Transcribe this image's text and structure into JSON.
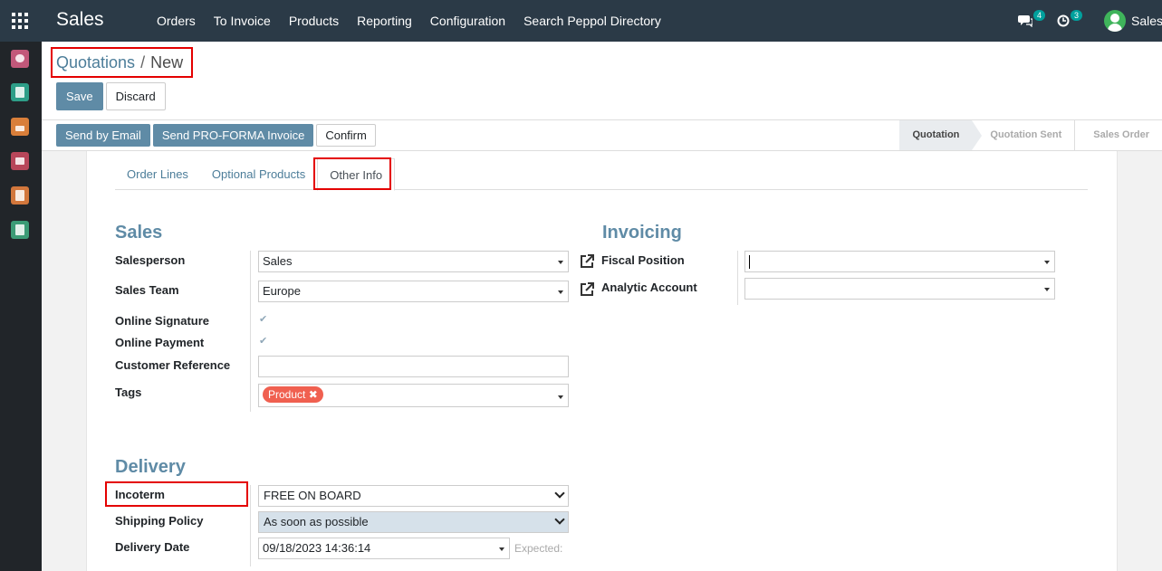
{
  "topbar": {
    "app_title": "Sales",
    "menu": [
      "Orders",
      "To Invoice",
      "Products",
      "Reporting",
      "Configuration",
      "Search Peppol Directory"
    ],
    "messages_count": "4",
    "activities_count": "3",
    "user_name": "Sales"
  },
  "breadcrumb": {
    "parent": "Quotations",
    "separator": "/",
    "current": "New"
  },
  "actions": {
    "save": "Save",
    "discard": "Discard"
  },
  "statusbar": {
    "buttons": [
      "Send by Email",
      "Send PRO-FORMA Invoice",
      "Confirm"
    ],
    "stages": [
      "Quotation",
      "Quotation Sent",
      "Sales Order"
    ],
    "active_stage": "Quotation"
  },
  "tabs": [
    "Order Lines",
    "Optional Products",
    "Other Info"
  ],
  "active_tab": "Other Info",
  "sales": {
    "title": "Sales",
    "salesperson_label": "Salesperson",
    "salesperson_value": "Sales",
    "sales_team_label": "Sales Team",
    "sales_team_value": "Europe",
    "online_signature_label": "Online Signature",
    "online_signature_checked": true,
    "online_payment_label": "Online Payment",
    "online_payment_checked": true,
    "customer_reference_label": "Customer Reference",
    "customer_reference_value": "",
    "tags_label": "Tags",
    "tag": "Product"
  },
  "invoicing": {
    "title": "Invoicing",
    "fiscal_position_label": "Fiscal Position",
    "fiscal_position_value": "",
    "analytic_account_label": "Analytic Account",
    "analytic_account_value": ""
  },
  "delivery": {
    "title": "Delivery",
    "incoterm_label": "Incoterm",
    "incoterm_value": "FREE ON BOARD",
    "shipping_policy_label": "Shipping Policy",
    "shipping_policy_value": "As soon as possible",
    "delivery_date_label": "Delivery Date",
    "delivery_date_value": "09/18/2023 14:36:14",
    "expected_label": "Expected:"
  },
  "colors": {
    "navbar": "#2b3a47",
    "primary": "#5f8ba6",
    "highlight": "#e40000",
    "tag": "#f06050"
  },
  "sidebar_icons": [
    "discuss-icon",
    "contacts-icon",
    "sales-chart-icon",
    "inventory-icon",
    "invoicing-icon",
    "documents-icon"
  ]
}
